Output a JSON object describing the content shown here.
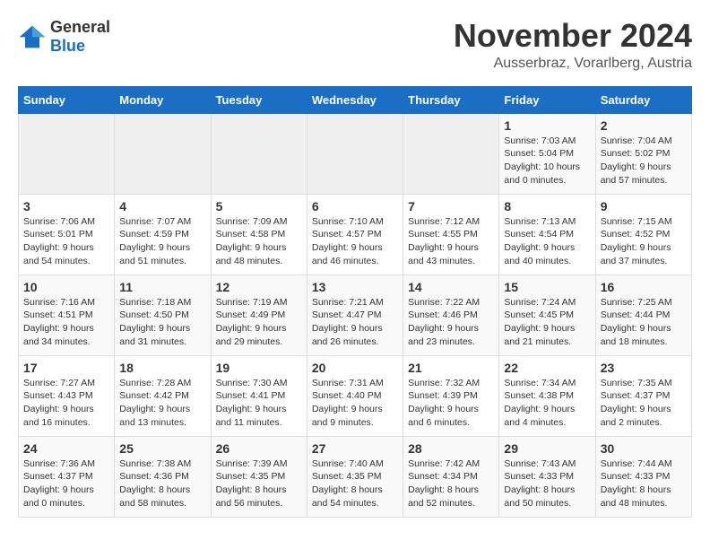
{
  "logo": {
    "text_general": "General",
    "text_blue": "Blue"
  },
  "title": "November 2024",
  "subtitle": "Ausserbraz, Vorarlberg, Austria",
  "days_of_week": [
    "Sunday",
    "Monday",
    "Tuesday",
    "Wednesday",
    "Thursday",
    "Friday",
    "Saturday"
  ],
  "weeks": [
    [
      {
        "day": "",
        "info": ""
      },
      {
        "day": "",
        "info": ""
      },
      {
        "day": "",
        "info": ""
      },
      {
        "day": "",
        "info": ""
      },
      {
        "day": "",
        "info": ""
      },
      {
        "day": "1",
        "info": "Sunrise: 7:03 AM\nSunset: 5:04 PM\nDaylight: 10 hours and 0 minutes."
      },
      {
        "day": "2",
        "info": "Sunrise: 7:04 AM\nSunset: 5:02 PM\nDaylight: 9 hours and 57 minutes."
      }
    ],
    [
      {
        "day": "3",
        "info": "Sunrise: 7:06 AM\nSunset: 5:01 PM\nDaylight: 9 hours and 54 minutes."
      },
      {
        "day": "4",
        "info": "Sunrise: 7:07 AM\nSunset: 4:59 PM\nDaylight: 9 hours and 51 minutes."
      },
      {
        "day": "5",
        "info": "Sunrise: 7:09 AM\nSunset: 4:58 PM\nDaylight: 9 hours and 48 minutes."
      },
      {
        "day": "6",
        "info": "Sunrise: 7:10 AM\nSunset: 4:57 PM\nDaylight: 9 hours and 46 minutes."
      },
      {
        "day": "7",
        "info": "Sunrise: 7:12 AM\nSunset: 4:55 PM\nDaylight: 9 hours and 43 minutes."
      },
      {
        "day": "8",
        "info": "Sunrise: 7:13 AM\nSunset: 4:54 PM\nDaylight: 9 hours and 40 minutes."
      },
      {
        "day": "9",
        "info": "Sunrise: 7:15 AM\nSunset: 4:52 PM\nDaylight: 9 hours and 37 minutes."
      }
    ],
    [
      {
        "day": "10",
        "info": "Sunrise: 7:16 AM\nSunset: 4:51 PM\nDaylight: 9 hours and 34 minutes."
      },
      {
        "day": "11",
        "info": "Sunrise: 7:18 AM\nSunset: 4:50 PM\nDaylight: 9 hours and 31 minutes."
      },
      {
        "day": "12",
        "info": "Sunrise: 7:19 AM\nSunset: 4:49 PM\nDaylight: 9 hours and 29 minutes."
      },
      {
        "day": "13",
        "info": "Sunrise: 7:21 AM\nSunset: 4:47 PM\nDaylight: 9 hours and 26 minutes."
      },
      {
        "day": "14",
        "info": "Sunrise: 7:22 AM\nSunset: 4:46 PM\nDaylight: 9 hours and 23 minutes."
      },
      {
        "day": "15",
        "info": "Sunrise: 7:24 AM\nSunset: 4:45 PM\nDaylight: 9 hours and 21 minutes."
      },
      {
        "day": "16",
        "info": "Sunrise: 7:25 AM\nSunset: 4:44 PM\nDaylight: 9 hours and 18 minutes."
      }
    ],
    [
      {
        "day": "17",
        "info": "Sunrise: 7:27 AM\nSunset: 4:43 PM\nDaylight: 9 hours and 16 minutes."
      },
      {
        "day": "18",
        "info": "Sunrise: 7:28 AM\nSunset: 4:42 PM\nDaylight: 9 hours and 13 minutes."
      },
      {
        "day": "19",
        "info": "Sunrise: 7:30 AM\nSunset: 4:41 PM\nDaylight: 9 hours and 11 minutes."
      },
      {
        "day": "20",
        "info": "Sunrise: 7:31 AM\nSunset: 4:40 PM\nDaylight: 9 hours and 9 minutes."
      },
      {
        "day": "21",
        "info": "Sunrise: 7:32 AM\nSunset: 4:39 PM\nDaylight: 9 hours and 6 minutes."
      },
      {
        "day": "22",
        "info": "Sunrise: 7:34 AM\nSunset: 4:38 PM\nDaylight: 9 hours and 4 minutes."
      },
      {
        "day": "23",
        "info": "Sunrise: 7:35 AM\nSunset: 4:37 PM\nDaylight: 9 hours and 2 minutes."
      }
    ],
    [
      {
        "day": "24",
        "info": "Sunrise: 7:36 AM\nSunset: 4:37 PM\nDaylight: 9 hours and 0 minutes."
      },
      {
        "day": "25",
        "info": "Sunrise: 7:38 AM\nSunset: 4:36 PM\nDaylight: 8 hours and 58 minutes."
      },
      {
        "day": "26",
        "info": "Sunrise: 7:39 AM\nSunset: 4:35 PM\nDaylight: 8 hours and 56 minutes."
      },
      {
        "day": "27",
        "info": "Sunrise: 7:40 AM\nSunset: 4:35 PM\nDaylight: 8 hours and 54 minutes."
      },
      {
        "day": "28",
        "info": "Sunrise: 7:42 AM\nSunset: 4:34 PM\nDaylight: 8 hours and 52 minutes."
      },
      {
        "day": "29",
        "info": "Sunrise: 7:43 AM\nSunset: 4:33 PM\nDaylight: 8 hours and 50 minutes."
      },
      {
        "day": "30",
        "info": "Sunrise: 7:44 AM\nSunset: 4:33 PM\nDaylight: 8 hours and 48 minutes."
      }
    ]
  ]
}
